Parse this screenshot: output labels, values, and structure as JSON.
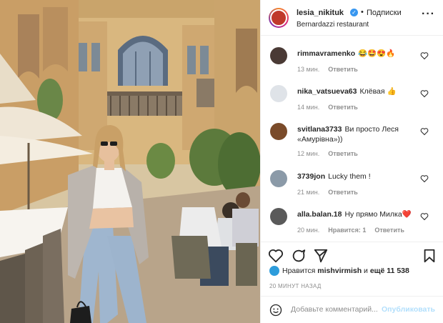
{
  "post": {
    "author": "lesia_nikituk",
    "follow_label": "Подписки",
    "location": "Bernardazzi restaurant",
    "verified_icon": "verified-badge-icon",
    "more_icon": "more-options-icon"
  },
  "comments": [
    {
      "user": "rimmavramenko",
      "text": "😂🤩😍🔥",
      "time": "13 мин.",
      "likes": "",
      "reply": "Ответить",
      "avatar_color": "#4a3a35"
    },
    {
      "user": "nika_vatsueva63",
      "text": "Клёвая 👍",
      "time": "14 мин.",
      "likes": "",
      "reply": "Ответить",
      "avatar_color": "#dfe3e8"
    },
    {
      "user": "svitlana3733",
      "text": "Ви просто Леся «Амурівна»))",
      "time": "12 мин.",
      "likes": "",
      "reply": "Ответить",
      "avatar_color": "#7a4b2a"
    },
    {
      "user": "3739jon",
      "text": "Lucky them !",
      "time": "21 мин.",
      "likes": "",
      "reply": "Ответить",
      "avatar_color": "#8b9aa8"
    },
    {
      "user": "alla.balan.18",
      "text": "Ну прямо Милка❤️",
      "time": "20 мин.",
      "likes": "Нравится: 1",
      "reply": "Ответить",
      "avatar_color": "#5a5a5a"
    }
  ],
  "likes": {
    "prefix": "Нравится",
    "user": "mishvirmish",
    "middle": "и",
    "count": "ещё 11 538"
  },
  "timestamp": "20 МИНУТ НАЗАД",
  "comment_box": {
    "placeholder": "Добавьте комментарий...",
    "post_label": "Опубликовать"
  },
  "icons": {
    "like": "heart-icon",
    "comment": "comment-icon",
    "share": "share-icon",
    "save": "bookmark-icon",
    "emoji": "emoji-icon"
  },
  "colors": {
    "verified": "#3897f0",
    "post_button_disabled": "#b2dffc",
    "like_heart": "#ed4956"
  }
}
